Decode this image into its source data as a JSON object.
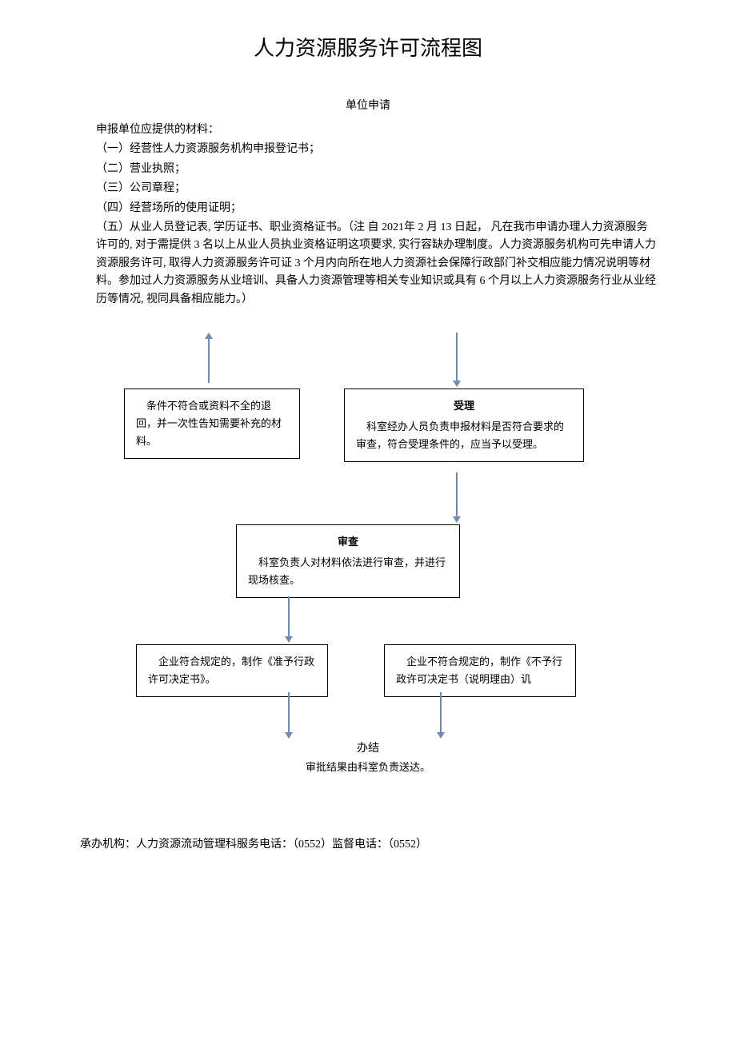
{
  "title": "人力资源服务许可流程图",
  "application": {
    "section_title": "单位申请",
    "intro": "申报单位应提供的材料：",
    "items": [
      "（一）经营性人力资源服务机构申报登记书；",
      "（二）营业执照；",
      "（三）公司章程；",
      "（四）经营场所的使用证明；",
      "（五）从业人员登记表, 学历证书、职业资格证书。（注  自 2021年 2 月 13 日起， 凡在我市申请办理人力资源服务许可的, 对于需提供 3 名以上从业人员执业资格证明这项要求, 实行容缺办理制度。人力资源服务机构可先申请人力资源服务许可, 取得人力资源服务许可证 3 个月内向所在地人力资源社会保障行政部门补交相应能力情况说明等材料。参加过人力资源服务从业培训、具备人力资源管理等相关专业知识或具有 6 个月以上人力资源服务行业从业经历等情况, 视同具备相应能力。）"
    ]
  },
  "reject_box": "　条件不符合或资料不全的退回，并一次性告知需要补充的材料。",
  "accept_box": {
    "title": "受理",
    "text": "　科室经办人员负责申报材料是否符合要求的审查，符合受理条件的，应当予以受理。"
  },
  "review_box": {
    "title": "审查",
    "text": "　科室负责人对材料依法进行审查，并进行现场核查。"
  },
  "approve_box": "　企业符合规定的，制作《准予行政许可决定书》。",
  "deny_box": "　企业不符合规定的，制作《不予行政许可决定书（说明理由）讥",
  "complete": {
    "title": "办结",
    "text": "审批结果由科室负责送达。"
  },
  "footer": "承办机构：人力资源流动管理科服务电话：（0552）监督电话：（0552）"
}
